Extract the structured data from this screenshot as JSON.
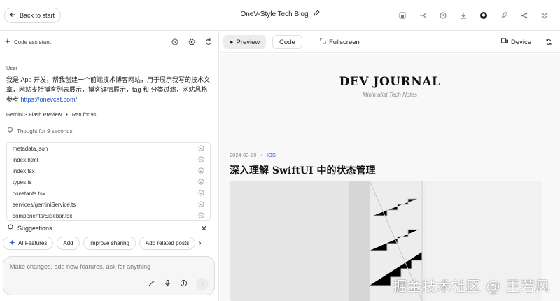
{
  "header": {
    "back_label": "Back to start",
    "title": "OneV-Style Tech Blog",
    "icons": [
      "save-icon",
      "branch-icon",
      "history-icon",
      "download-icon",
      "github-icon",
      "rocket-icon",
      "share-icon",
      "collapse-icon"
    ]
  },
  "assistant": {
    "label": "Code assistant",
    "icons": [
      "history-icon",
      "settings-icon",
      "refresh-icon"
    ]
  },
  "chat": {
    "user_label": "User",
    "user_message": "我是 App 开发，帮我创建一个前端技术博客网站，用于展示我写的技术文章，网站支持博客列表展示，博客详情展示，tag 和 分类过滤，网站风格参考",
    "user_link": "https://onevcat.com/",
    "model": "Gemini 3 Flash Preview",
    "run_time": "Ran for 9s",
    "thought": "Thought for 9 seconds"
  },
  "files": [
    {
      "name": "metadata.json"
    },
    {
      "name": "index.html"
    },
    {
      "name": "index.tsx"
    },
    {
      "name": "types.ts"
    },
    {
      "name": "constants.tsx"
    },
    {
      "name": "services/geminiService.ts"
    },
    {
      "name": "components/Sidebar.tsx"
    }
  ],
  "suggestions": {
    "title": "Suggestions",
    "chips": [
      "AI Features",
      "Add",
      "Improve sharing",
      "Add related posts"
    ]
  },
  "input": {
    "placeholder": "Make changes, add new features, ask for anything"
  },
  "preview_toolbar": {
    "preview": "Preview",
    "code": "Code",
    "fullscreen": "Fullscreen",
    "device": "Device"
  },
  "blog": {
    "title": "DEV JOURNAL",
    "subtitle": "Minimalist Tech Notes",
    "post_date": "2024-03-20",
    "post_tag": "IOS",
    "post_title": "深入理解 SwiftUI 中的状态管理"
  },
  "watermark": "掘金技术社区 @ 王若风",
  "colors": {
    "accent_blue": "#2a5ad8",
    "link": "#1a56c9",
    "check": "#9aa49a"
  }
}
